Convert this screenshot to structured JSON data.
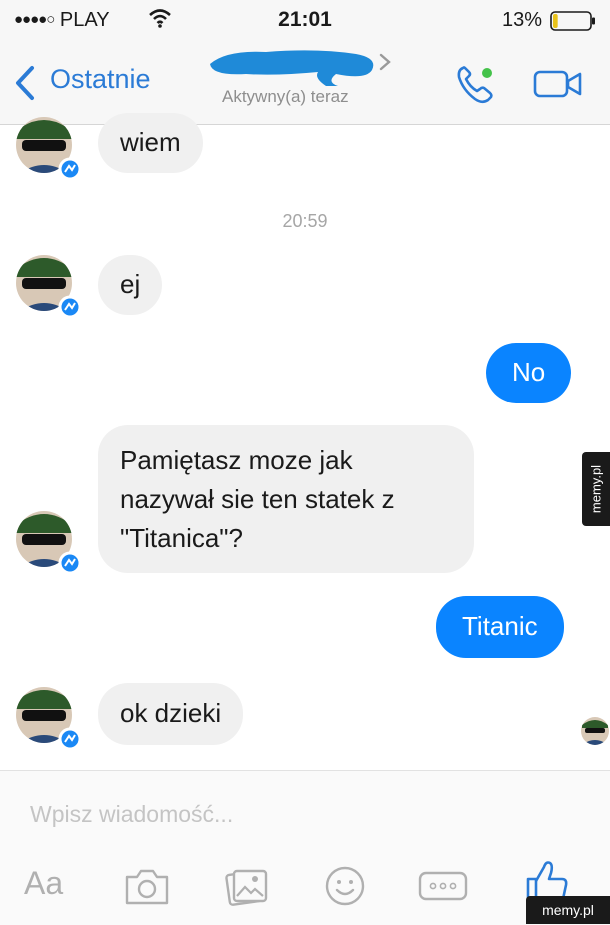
{
  "status_bar": {
    "carrier": "PLAY",
    "signal_dots": "●●●●○",
    "time": "21:01",
    "battery_percent": "13%",
    "battery_level": 0.13
  },
  "nav": {
    "back_label": "Ostatnie",
    "active_status": "Aktywny(a) teraz",
    "accent_color": "#2b7bd6"
  },
  "messages": [
    {
      "side": "in",
      "text_lines": [
        "wiem"
      ]
    },
    {
      "timestamp": "20:59"
    },
    {
      "side": "in",
      "text_lines": [
        "ej"
      ]
    },
    {
      "side": "out",
      "text_lines": [
        "No"
      ]
    },
    {
      "side": "in",
      "text_lines": [
        "Pamiętasz moze jak",
        "nazywał sie ten statek z",
        "\"Titanica\"?"
      ]
    },
    {
      "side": "out",
      "text_lines": [
        "Titanic"
      ]
    },
    {
      "side": "in",
      "text_lines": [
        "ok dzieki"
      ]
    }
  ],
  "composer": {
    "placeholder": "Wpisz wiadomość...",
    "aa_label": "Aa",
    "icons": [
      "camera-icon",
      "gallery-icon",
      "emoji-icon",
      "more-icon",
      "like-icon"
    ]
  },
  "watermark": {
    "side_text": "memy.pl",
    "corner_text": "memy.pl"
  },
  "colors": {
    "outgoing_bubble": "#0a84ff",
    "incoming_bubble": "#f0f0f0"
  }
}
